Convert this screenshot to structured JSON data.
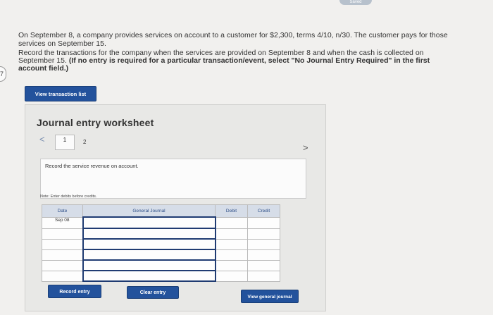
{
  "top_badge": "Saved",
  "side_tab": "7",
  "problem": {
    "paragraph1": "On September 8, a company provides services on account to a customer for $2,300, terms 4/10, n/30. The customer pays for those services on September 15.",
    "paragraph2_plain": "Record the transactions for the company when the services are provided on September 8 and when the cash is collected on September 15.",
    "paragraph2_bold": "(If no entry is required for a particular transaction/event, select \"No Journal Entry Required\" in the first account field.)"
  },
  "view_transaction_list": "View transaction list",
  "worksheet": {
    "title": "Journal entry worksheet",
    "prev_glyph": "<",
    "next_glyph": ">",
    "tabs": [
      "1",
      "2"
    ],
    "description": "Record the service revenue on account.",
    "note": "Note: Enter debits before credits.",
    "table": {
      "headers": [
        "Date",
        "General Journal",
        "Debit",
        "Credit"
      ],
      "rows": [
        {
          "date": "Sep 08",
          "account": "",
          "debit": "",
          "credit": ""
        },
        {
          "date": "",
          "account": "",
          "debit": "",
          "credit": ""
        },
        {
          "date": "",
          "account": "",
          "debit": "",
          "credit": ""
        },
        {
          "date": "",
          "account": "",
          "debit": "",
          "credit": ""
        },
        {
          "date": "",
          "account": "",
          "debit": "",
          "credit": ""
        },
        {
          "date": "",
          "account": "",
          "debit": "",
          "credit": ""
        }
      ]
    },
    "buttons": {
      "record": "Record entry",
      "clear": "Clear entry",
      "view_general_journal": "View general journal"
    }
  },
  "colors": {
    "button_blue": "#23529c",
    "header_blue": "#d6dde8",
    "active_border": "#1f3b72"
  }
}
